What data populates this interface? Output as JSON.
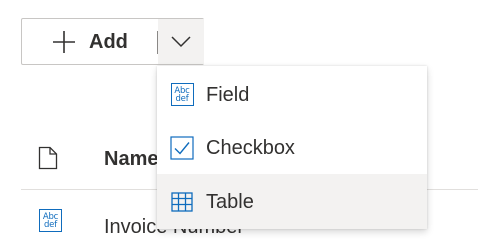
{
  "toolbar": {
    "add_label": "Add",
    "add_icon": "plus-icon",
    "dropdown_icon": "chevron-down-icon"
  },
  "menu": {
    "items": [
      {
        "label": "Field",
        "icon": "abc-def-icon",
        "icon_text_top": "Abc",
        "icon_text_bottom": "def"
      },
      {
        "label": "Checkbox",
        "icon": "checkbox-icon"
      },
      {
        "label": "Table",
        "icon": "table-icon",
        "hovered": true
      }
    ]
  },
  "list": {
    "columns": [
      {
        "label": "Name",
        "icon": "document-icon"
      }
    ],
    "rows": [
      {
        "name": "Invoice Number",
        "icon": "abc-def-icon",
        "icon_text_top": "Abc",
        "icon_text_bottom": "def"
      }
    ]
  },
  "colors": {
    "accent": "#0f6cbd",
    "text": "#323130",
    "border": "#c8c6c4",
    "hover_background": "#f3f2f1"
  }
}
